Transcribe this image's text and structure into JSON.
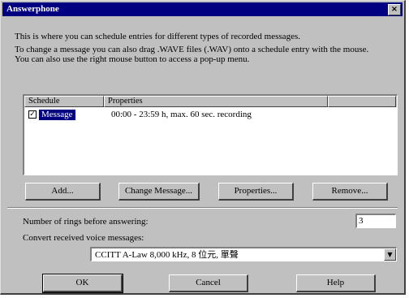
{
  "window": {
    "title": "Answerphone",
    "close_glyph": "×"
  },
  "description": {
    "line1": "This is where you can schedule entries for different types of recorded messages.",
    "line2": "To change a message you can also drag .WAVE files (.WAV) onto a schedule entry with the mouse.",
    "line3": "You can also use the right mouse button to access a pop-up menu."
  },
  "schedule_list": {
    "columns": [
      "Schedule",
      "Properties"
    ],
    "rows": [
      {
        "checked": true,
        "check_glyph": "✓",
        "label": "Message",
        "properties": "00:00 - 23:59 h, max. 60 sec. recording"
      }
    ]
  },
  "list_buttons": {
    "add": "Add...",
    "change_message": "Change Message...",
    "properties": "Properties...",
    "remove": "Remove..."
  },
  "rings": {
    "label": "Number of rings before answering:",
    "value": "3"
  },
  "convert": {
    "label": "Convert received voice messages:",
    "selected": "CCITT A-Law 8,000 kHz, 8 位元, 單聲"
  },
  "dialog_buttons": {
    "ok": "OK",
    "cancel": "Cancel",
    "help": "Help"
  }
}
